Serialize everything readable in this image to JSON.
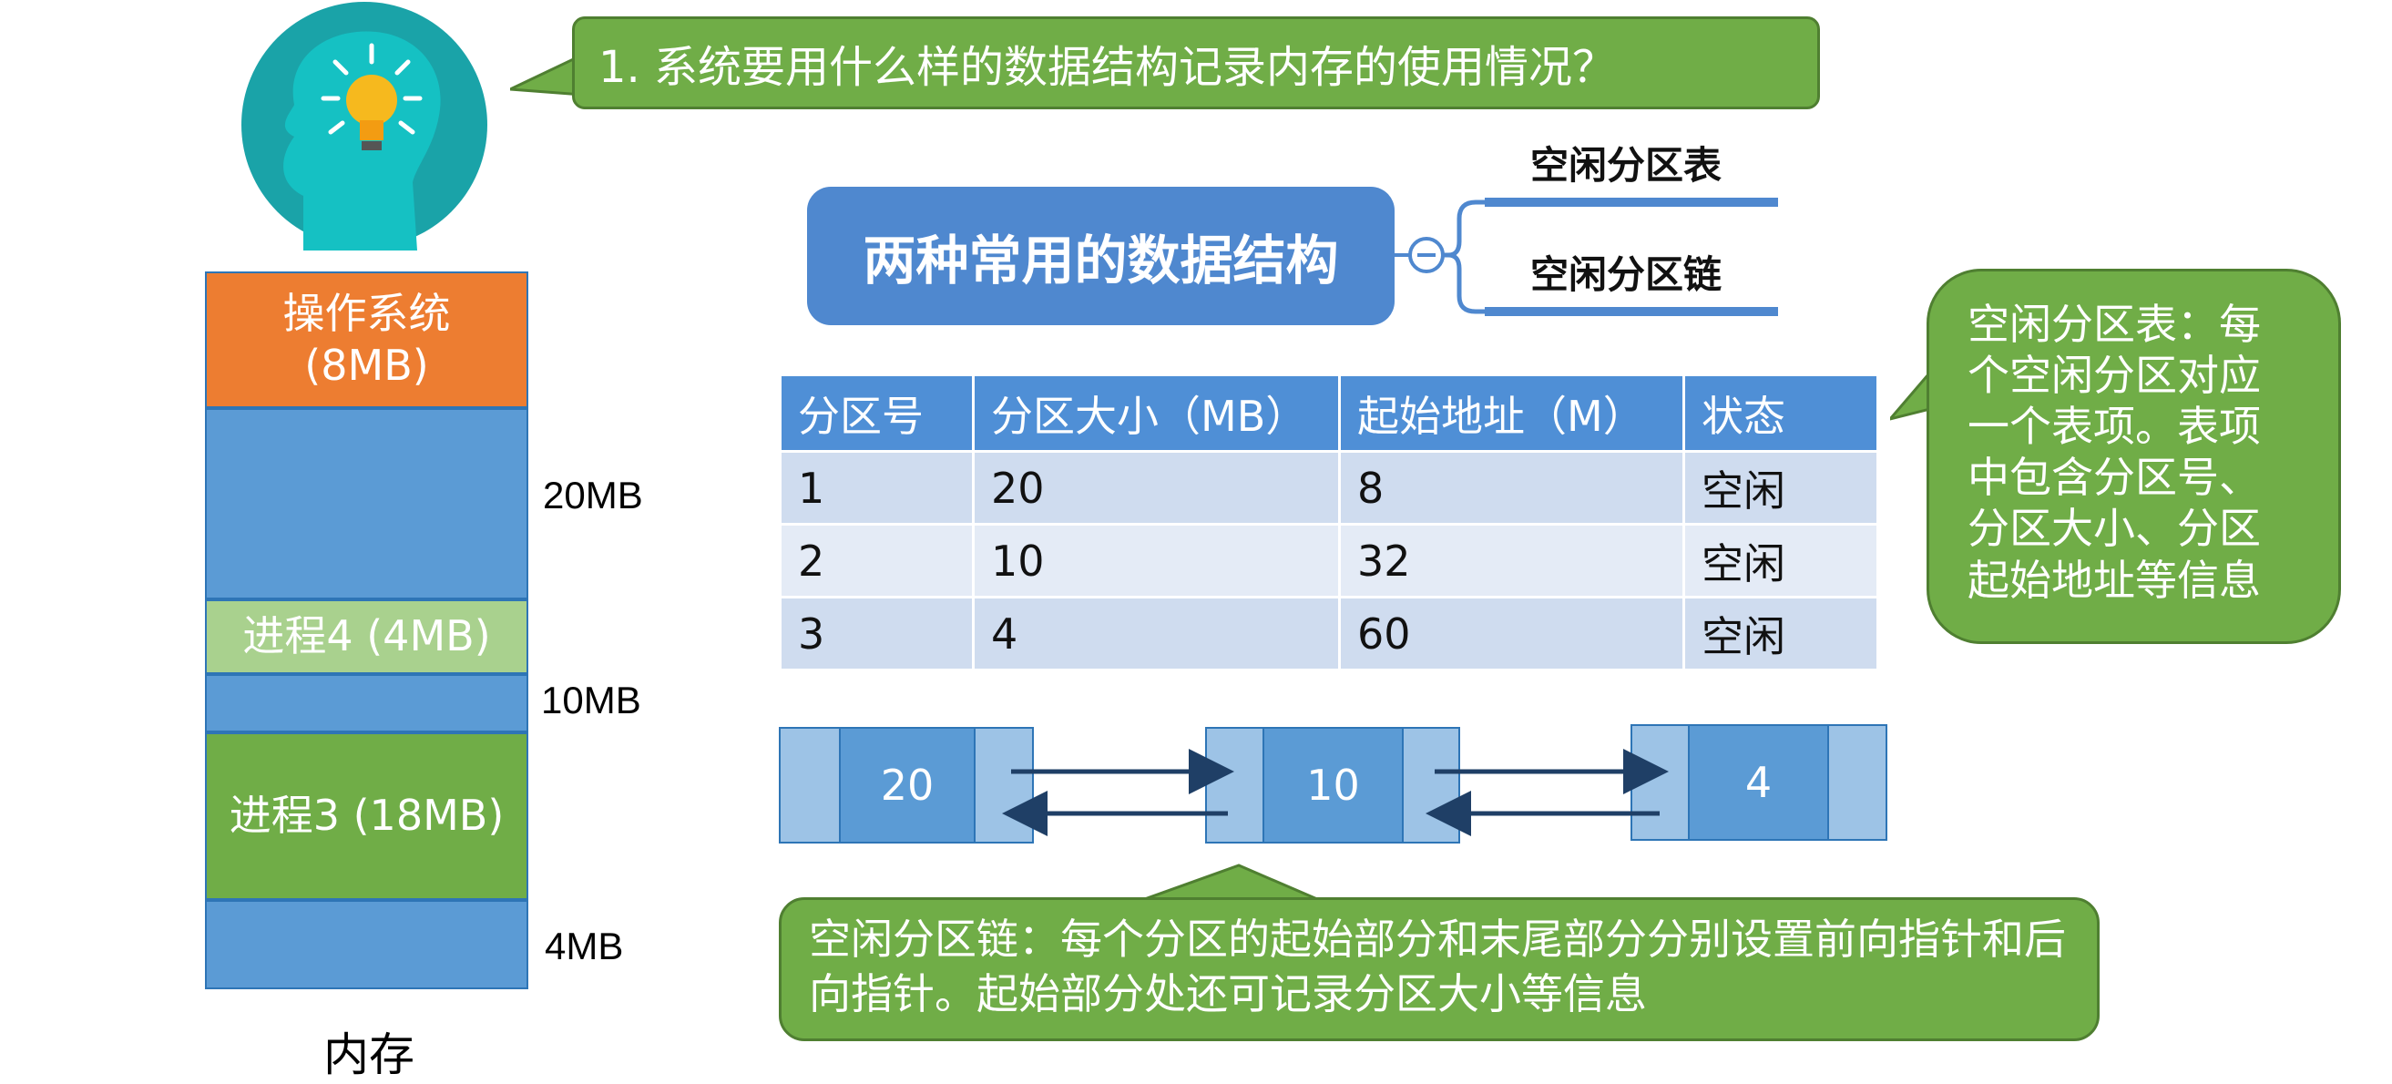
{
  "question": "1. 系统要用什么样的数据结构记录内存的使用情况？",
  "memory": {
    "label": "内存",
    "blocks": [
      {
        "name": "操作系统",
        "sub": "(8MB)"
      },
      {
        "name": ""
      },
      {
        "name": "进程4 (4MB)"
      },
      {
        "name": ""
      },
      {
        "name": "进程3 (18MB)"
      },
      {
        "name": ""
      }
    ],
    "sizes": [
      "20MB",
      "10MB",
      "4MB"
    ],
    "colors": {
      "os": "#ed7d31",
      "free": "#5b9bd5",
      "process4": "#a9d18e",
      "process3": "#70ad47"
    }
  },
  "mindmap": {
    "title": "两种常用的数据结构",
    "branches": [
      "空闲分区表",
      "空闲分区链"
    ]
  },
  "table": {
    "headers": [
      "分区号",
      "分区大小（MB）",
      "起始地址（M）",
      "状态"
    ],
    "rows": [
      [
        "1",
        "20",
        "8",
        "空闲"
      ],
      [
        "2",
        "10",
        "32",
        "空闲"
      ],
      [
        "3",
        "4",
        "60",
        "空闲"
      ]
    ]
  },
  "table_note": "空闲分区表：每个空闲分区对应一个表项。表项中包含分区号、分区大小、分区起始地址等信息",
  "chain": {
    "nodes": [
      "20",
      "10",
      "4"
    ]
  },
  "chain_note": "空闲分区链：每个分区的起始部分和末尾部分分别设置前向指针和后向指针。起始部分处还可记录分区大小等信息",
  "icons": [
    "head-lightbulb-icon",
    "collapse-icon"
  ]
}
